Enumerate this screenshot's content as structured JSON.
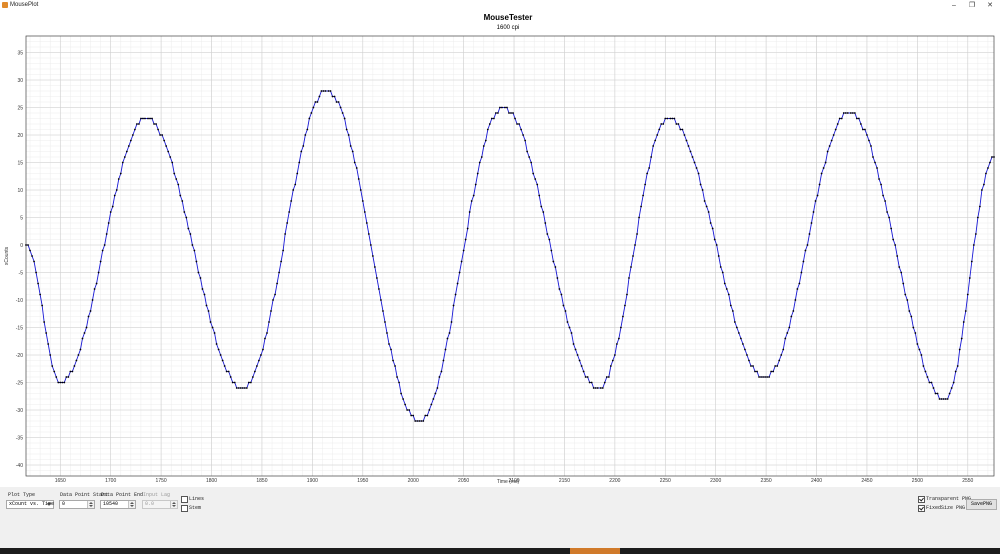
{
  "window": {
    "title": "MouseTester",
    "app_name": "MousePlot",
    "controls": {
      "minimize": "–",
      "maximize": "❐",
      "close": "✕"
    }
  },
  "chart_data": {
    "type": "scatter",
    "title": "MouseTester",
    "subtitle": "1600 cpi",
    "xlabel": "Time (ms)",
    "ylabel": "xCounts",
    "xlim": [
      1616,
      2576
    ],
    "ylim": [
      -42,
      38
    ],
    "x_ticks": [
      1650,
      1700,
      1750,
      1800,
      1850,
      1900,
      1950,
      2000,
      2050,
      2100,
      2150,
      2200,
      2250,
      2300,
      2350,
      2400,
      2450,
      2500,
      2550
    ],
    "y_ticks": [
      35,
      30,
      25,
      20,
      15,
      10,
      5,
      0,
      -5,
      -10,
      -15,
      -20,
      -25,
      -30,
      -35,
      -40
    ],
    "grid": true,
    "series": [
      {
        "name": "",
        "color": "#1a1ad6",
        "marker_color": "#000000",
        "x": [
          1616,
          1650,
          1735,
          1831,
          1914,
          2006,
          2089,
          2184,
          2253,
          2349,
          2432,
          2528,
          2576
        ],
        "y": [
          0,
          -25,
          23,
          -26,
          28,
          -32,
          25,
          -26,
          23,
          -24,
          24,
          -28,
          16
        ]
      }
    ]
  },
  "controls": {
    "plot_type_label": "Plot Type",
    "plot_type_value": "xCount vs. Time",
    "data_point_start_label": "Data Point Start",
    "data_point_start_value": "0",
    "data_point_end_label": "Data Point End",
    "data_point_end_value": "10540",
    "input_lag_label": "Input Lag",
    "input_lag_value": "0.0",
    "lines_label": "Lines",
    "lines_checked": false,
    "stem_label": "Stem",
    "stem_checked": false,
    "transparent_png_label": "Transparent PNG",
    "transparent_png_checked": true,
    "fixed_size_png_label": "FixedSize PNG",
    "fixed_size_png_checked": true,
    "save_png_label": "SavePNG"
  }
}
